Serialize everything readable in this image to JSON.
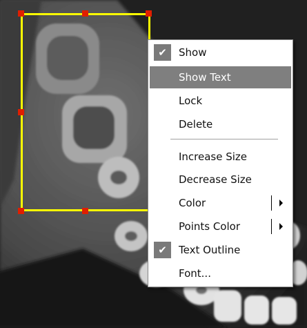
{
  "menu": {
    "items": [
      {
        "label": "Show",
        "checked": true
      },
      {
        "label": "Show Text",
        "highlighted": true
      },
      {
        "label": "Lock"
      },
      {
        "label": "Delete"
      },
      {
        "label": "Increase Size"
      },
      {
        "label": "Decrease Size"
      },
      {
        "label": "Color",
        "submenu": true
      },
      {
        "label": "Points Color",
        "submenu": true
      },
      {
        "label": "Text Outline",
        "checked": true
      },
      {
        "label": "Font..."
      }
    ],
    "check_glyph": "✔",
    "highlight_color": "#7f7f7f"
  },
  "roi": {
    "border_color": "#ffff00",
    "handle_color": "#e01e00"
  }
}
